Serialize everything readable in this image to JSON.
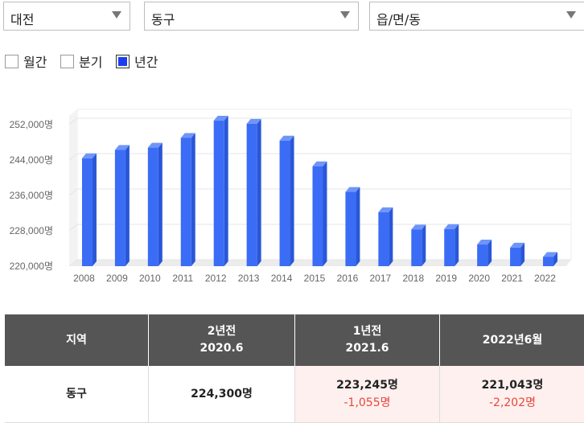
{
  "selectors": [
    {
      "label": "대전"
    },
    {
      "label": "동구"
    },
    {
      "label": "읍/면/동"
    }
  ],
  "period_options": [
    {
      "label": "월간",
      "checked": false
    },
    {
      "label": "분기",
      "checked": false
    },
    {
      "label": "년간",
      "checked": true
    }
  ],
  "chart_data": {
    "type": "bar",
    "categories": [
      "2008",
      "2009",
      "2010",
      "2011",
      "2012",
      "2013",
      "2014",
      "2015",
      "2016",
      "2017",
      "2018",
      "2019",
      "2020",
      "2021",
      "2022"
    ],
    "series": [
      {
        "values": [
          244400,
          246300,
          246800,
          249000,
          252900,
          252200,
          248400,
          242600,
          236800,
          232200,
          228300,
          228400,
          224900,
          224200,
          222100
        ]
      }
    ],
    "ylim": [
      220000,
      254000
    ],
    "yticks": [
      220000,
      228000,
      236000,
      244000,
      252000
    ],
    "ytick_labels": [
      "220,000명",
      "228,000명",
      "236,000명",
      "244,000명",
      "252,000명"
    ],
    "bar_color": "#3b6cf5",
    "grid": true
  },
  "table": {
    "headers": [
      {
        "line1": "지역",
        "line2": ""
      },
      {
        "line1": "2년전",
        "line2": "2020.6"
      },
      {
        "line1": "1년전",
        "line2": "2021.6"
      },
      {
        "line1": "2022년6월",
        "line2": ""
      }
    ],
    "row": {
      "region": "동구",
      "two_years": "224,300명",
      "one_year": "223,245명",
      "one_year_change": "-1,055명",
      "current": "221,043명",
      "current_change": "-2,202명"
    }
  }
}
